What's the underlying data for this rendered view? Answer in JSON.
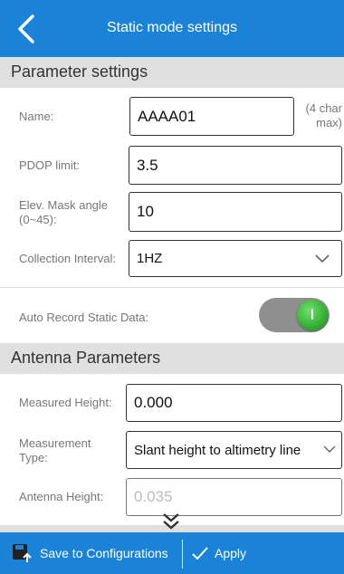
{
  "header": {
    "title": "Static mode settings"
  },
  "sections": {
    "parameter": "Parameter settings",
    "antenna": "Antenna Parameters"
  },
  "fields": {
    "name": {
      "label": "Name:",
      "value": "AAAA01",
      "hint_line1": "(4 char",
      "hint_line2": "max)"
    },
    "pdop": {
      "label": "PDOP limit:",
      "value": "3.5"
    },
    "elev": {
      "label_line1": "Elev. Mask angle",
      "label_line2": "(0~45):",
      "value": "10"
    },
    "interval": {
      "label": "Collection Interval:",
      "value": "1HZ"
    },
    "auto_record": {
      "label": "Auto Record Static Data:",
      "enabled": true
    },
    "measured_height": {
      "label": "Measured Height:",
      "value": "0.000"
    },
    "measurement_type": {
      "label_line1": "Measurement",
      "label_line2": "Type:",
      "value": "Slant height to altimetry line"
    },
    "antenna_height": {
      "label": "Antenna Height:",
      "value": "0.035"
    }
  },
  "footer": {
    "save_label": "Save to Configurations",
    "apply_label": "Apply"
  },
  "colors": {
    "accent": "#1a83d8",
    "section_bg": "#e0e0e0",
    "toggle_on": "#2aa82a"
  },
  "icons": [
    "back-arrow-icon",
    "chevron-down-icon",
    "save-icon",
    "checkmark-icon",
    "double-chevron-down-icon"
  ]
}
